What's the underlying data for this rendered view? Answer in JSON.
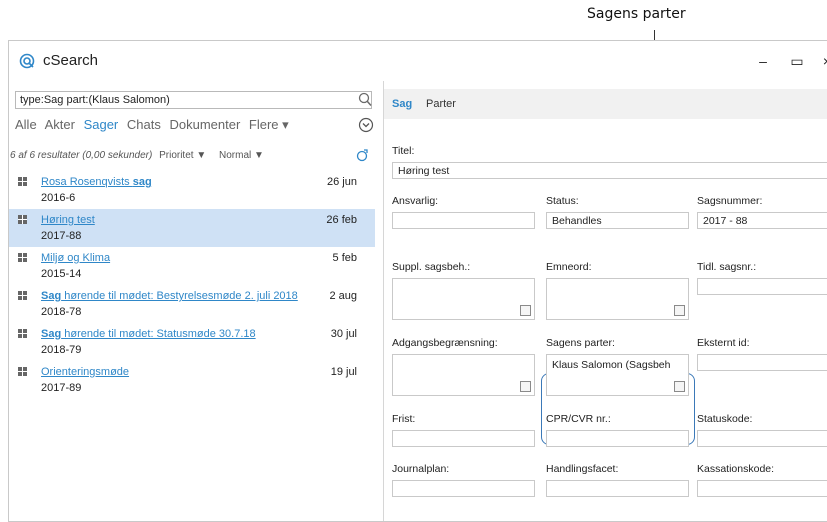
{
  "callout": {
    "label": "Sagens parter"
  },
  "app": {
    "title": "cSearch",
    "minimize": "–",
    "maximize": "▭",
    "close": "×"
  },
  "search": {
    "value": "type:Sag part:(Klaus Salomon)"
  },
  "filters": [
    "Alle",
    "Akter",
    "Sager",
    "Chats",
    "Dokumenter",
    "Flere ▾"
  ],
  "results": {
    "info": "6 af 6 resultater (0,00 sekunder)",
    "sort_field": "Prioritet ▼",
    "sort_order": "Normal ▼",
    "items": [
      {
        "pre": "Rosa Rosenqvists ",
        "bold": "sag",
        "post": "",
        "date": "26 jun",
        "number": "2016-6"
      },
      {
        "pre": "Høring test",
        "bold": "",
        "post": "",
        "date": "26 feb",
        "number": "2017-88"
      },
      {
        "pre": "Miljø og Klima",
        "bold": "",
        "post": "",
        "date": "5 feb",
        "number": "2015-14"
      },
      {
        "pre": "",
        "bold": "Sag",
        "post": " hørende til mødet: Bestyrelsesmøde 2. juli 2018",
        "date": "2 aug",
        "number": "2018-78"
      },
      {
        "pre": "",
        "bold": "Sag",
        "post": " hørende til mødet: Statusmøde 30.7.18",
        "date": "30 jul",
        "number": "2018-79"
      },
      {
        "pre": "Orienteringsmøde",
        "bold": "",
        "post": "",
        "date": "19 jul",
        "number": "2017-89"
      }
    ]
  },
  "detail": {
    "tabs": [
      "Sag",
      "Parter"
    ],
    "titel": {
      "label": "Titel:",
      "value": "Høring test"
    },
    "ansvarlig": {
      "label": "Ansvarlig:",
      "value": ""
    },
    "status": {
      "label": "Status:",
      "value": "Behandles"
    },
    "sagsnummer": {
      "label": "Sagsnummer:",
      "value": "2017 - 88"
    },
    "suppl": {
      "label": "Suppl. sagsbeh.:"
    },
    "emneord": {
      "label": "Emneord:"
    },
    "tidl": {
      "label": "Tidl. sagsnr.:"
    },
    "adgang": {
      "label": "Adgangsbegrænsning:"
    },
    "parter": {
      "label": "Sagens parter:",
      "value": "Klaus Salomon (Sagsbeh"
    },
    "eksternt": {
      "label": "Eksternt id:"
    },
    "frist": {
      "label": "Frist:"
    },
    "cpr": {
      "label": "CPR/CVR nr.:"
    },
    "statuskode": {
      "label": "Statuskode:"
    },
    "journalplan": {
      "label": "Journalplan:"
    },
    "handlingsfacet": {
      "label": "Handlingsfacet:"
    },
    "kassation": {
      "label": "Kassationskode:"
    }
  },
  "colors": {
    "accent": "#2f87c8",
    "selected": "#cfe1f5",
    "highlight": "#3b79b8"
  }
}
